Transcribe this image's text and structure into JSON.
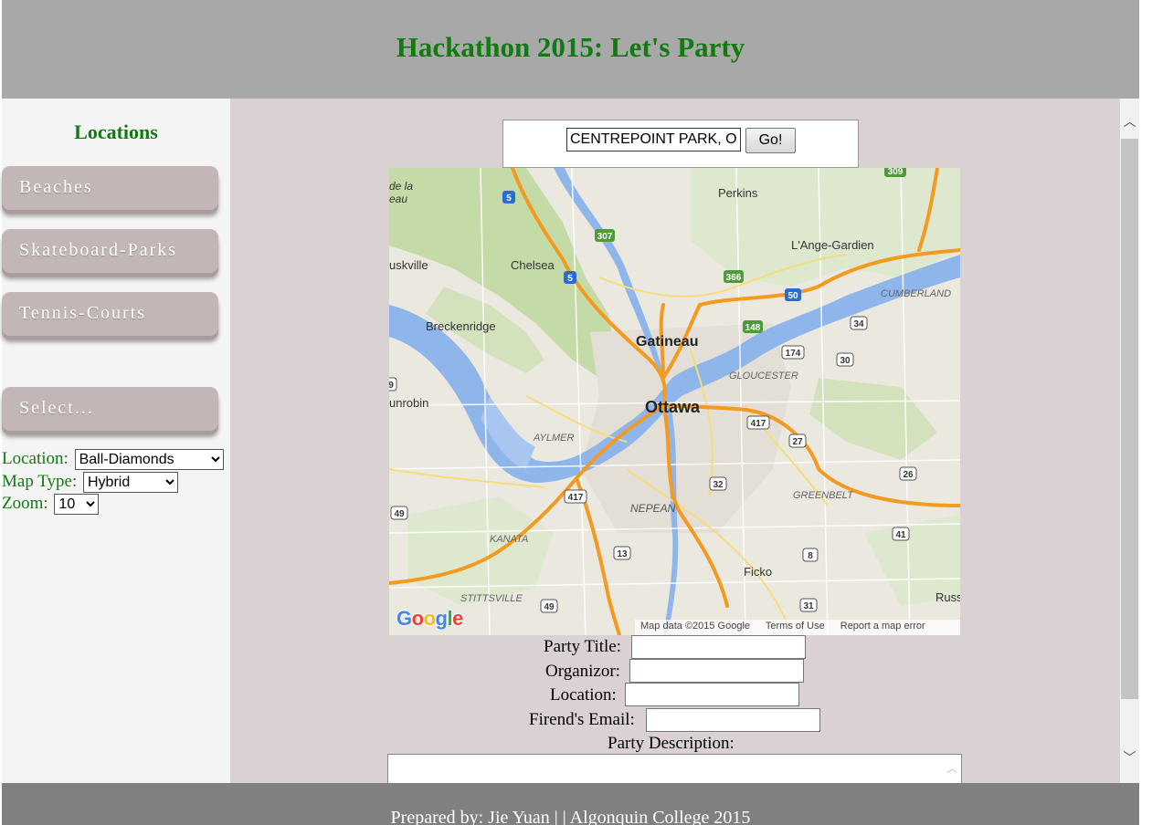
{
  "header": {
    "title": "Hackathon 2015: Let's Party"
  },
  "sidebar": {
    "heading": "Locations",
    "buttons": [
      "Beaches",
      "Skateboard-Parks",
      "Tennis-Courts"
    ],
    "select_button": "Select...",
    "location_label": "Location:",
    "location_value": "Ball-Diamonds",
    "map_type_label": "Map Type:",
    "map_type_value": "Hybrid",
    "zoom_label": "Zoom:",
    "zoom_value": "10"
  },
  "search": {
    "value": "CENTREPOINT PARK, O",
    "go_label": "Go!"
  },
  "map": {
    "attribution": "Map data ©2015 Google",
    "terms": "Terms of Use",
    "report": "Report a map error",
    "logo": "Google",
    "places": {
      "ottawa": "Ottawa",
      "gatineau": "Gatineau",
      "chelsea": "Chelsea",
      "perkins": "Perkins",
      "lange_gardien": "L'Ange-Gardien",
      "cumberland": "CUMBERLAND",
      "breckenridge": "Breckenridge",
      "gloucester": "GLOUCESTER",
      "aylmer": "AYLMER",
      "nepean": "NEPEAN",
      "kanata": "KANATA",
      "greenbelt": "GREENBELT",
      "stittsville": "STITTSVILLE",
      "ficko": "Ficko",
      "uskville": "uskville",
      "unrobin": "unrobin",
      "de_la": "de la",
      "eau": "eau",
      "russ": "Russ"
    },
    "shields": [
      "5",
      "307",
      "5",
      "366",
      "50",
      "148",
      "34",
      "174",
      "30",
      "417",
      "27",
      "26",
      "32",
      "417",
      "13",
      "8",
      "41",
      "49",
      "49",
      "31",
      "309",
      "9"
    ]
  },
  "form": {
    "party_title_label": "Party Title:",
    "organizor_label": "Organizor:",
    "location_label": "Location:",
    "friend_email_label": "Firend's Email:",
    "description_label": "Party Description:"
  },
  "footer": {
    "text": "Prepared by: Jie Yuan | | Algonquin College 2015"
  },
  "colors": {
    "accent_green": "#117a11",
    "header_bg": "#a8a8a8",
    "main_bg": "#dad2d2",
    "button_bg": "#c2b6b6",
    "footer_bg": "#808080"
  }
}
